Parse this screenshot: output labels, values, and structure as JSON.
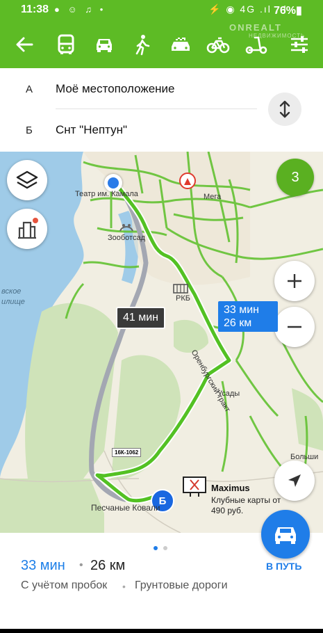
{
  "status_bar": {
    "time": "11:38",
    "icons": "● ☺ ♫ •",
    "right_icons": "⚡ ◉ 4G .ıl .ıl",
    "battery": "76%▮"
  },
  "toolbar": {
    "watermark": "ONREALT",
    "watermark_sub": "НЕДВИЖИМОСТЬ",
    "modes": [
      "back-arrow",
      "bus",
      "car",
      "pedestrian",
      "taxi",
      "bicycle",
      "scooter",
      "settings"
    ]
  },
  "route": {
    "from_letter": "А",
    "from_text": "Моё местоположение",
    "to_letter": "Б",
    "to_text": "Снт \"Нептун\""
  },
  "map": {
    "traffic_level": "3",
    "alt_route_time": "41 мин",
    "main_route_time": "33 мин",
    "main_route_dist": "26 км",
    "labels": {
      "theatre": "Театр им. Камала",
      "zoo": "Зооботсад",
      "mega": "Мега",
      "rkb": "РКБ",
      "orenburg_tract": "Оренбургский тракт",
      "usady": "Усады",
      "bolshie": "Больши",
      "peschanye": "Песчаные Ковали",
      "road_sign": "16К-1062",
      "left_partial_1": "вское",
      "left_partial_2": "илище"
    },
    "billboard_title": "Maximus",
    "billboard_sub": "Клубные карты от 490 руб.",
    "dest_letter": "Б"
  },
  "sheet": {
    "eta_time": "33 мин",
    "separator": "•",
    "eta_distance": "26 км",
    "note_traffic": "С учётом пробок",
    "note_roads": "Грунтовые дороги",
    "go_label": "В ПУТЬ"
  }
}
